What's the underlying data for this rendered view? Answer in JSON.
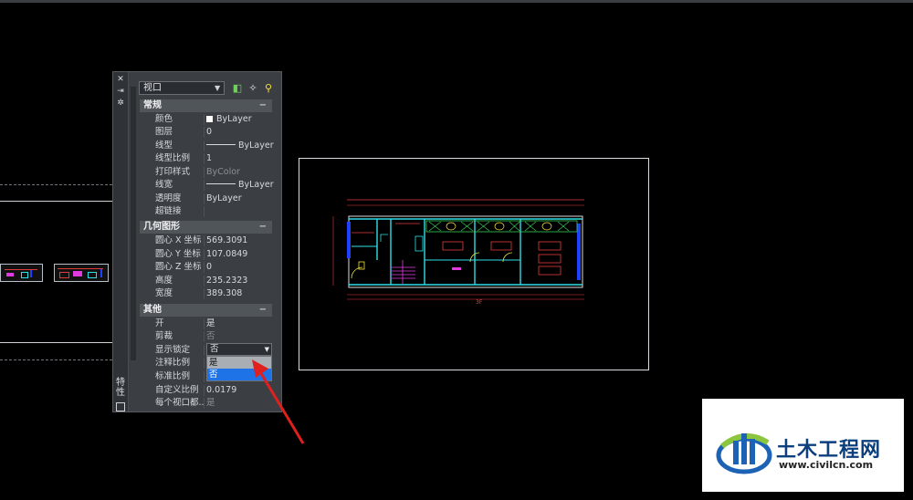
{
  "palette": {
    "title": "特性",
    "object_type": "视口",
    "icons": [
      "select-objects-icon",
      "pick-add-icon",
      "quick-select-icon"
    ],
    "categories": {
      "general": {
        "label": "常规",
        "rows": [
          {
            "key": "颜色",
            "value": "ByLayer"
          },
          {
            "key": "图层",
            "value": "0"
          },
          {
            "key": "线型",
            "value": "ByLayer"
          },
          {
            "key": "线型比例",
            "value": "1"
          },
          {
            "key": "打印样式",
            "value": "ByColor"
          },
          {
            "key": "线宽",
            "value": "ByLayer"
          },
          {
            "key": "透明度",
            "value": "ByLayer"
          },
          {
            "key": "超链接",
            "value": ""
          }
        ]
      },
      "geometry": {
        "label": "几何图形",
        "rows": [
          {
            "key": "圆心 X 坐标",
            "value": "569.3091"
          },
          {
            "key": "圆心 Y 坐标",
            "value": "107.0849"
          },
          {
            "key": "圆心 Z 坐标",
            "value": "0"
          },
          {
            "key": "高度",
            "value": "235.2323"
          },
          {
            "key": "宽度",
            "value": "389.308"
          }
        ]
      },
      "misc": {
        "label": "其他",
        "rows": [
          {
            "key": "开",
            "value": "是"
          },
          {
            "key": "剪裁",
            "value": "否"
          },
          {
            "key": "显示锁定",
            "value": "否"
          },
          {
            "key": "注释比例",
            "value": ""
          },
          {
            "key": "标准比例",
            "value": ""
          },
          {
            "key": "自定义比例",
            "value": "0.0179"
          },
          {
            "key": "每个视口都...",
            "value": "是"
          }
        ]
      }
    },
    "dropdown": {
      "current": "否",
      "options": [
        "是",
        "否"
      ],
      "highlighted": "否"
    }
  },
  "drawing": {
    "dimension_label": "3F"
  },
  "watermark": {
    "name": "土木工程网",
    "url": "www.civilcn.com"
  },
  "colors": {
    "background": "#000000",
    "palette_bg": "#3b3f44",
    "highlight": "#1e73e6",
    "arrow": "#e0201e",
    "cad_red": "#e03b3b",
    "cad_cyan": "#2ee0e6",
    "cad_yellow": "#f3e33a",
    "cad_blue": "#2040ff",
    "cad_magenta": "#e03be0",
    "brand_blue": "#0c3f7e"
  }
}
